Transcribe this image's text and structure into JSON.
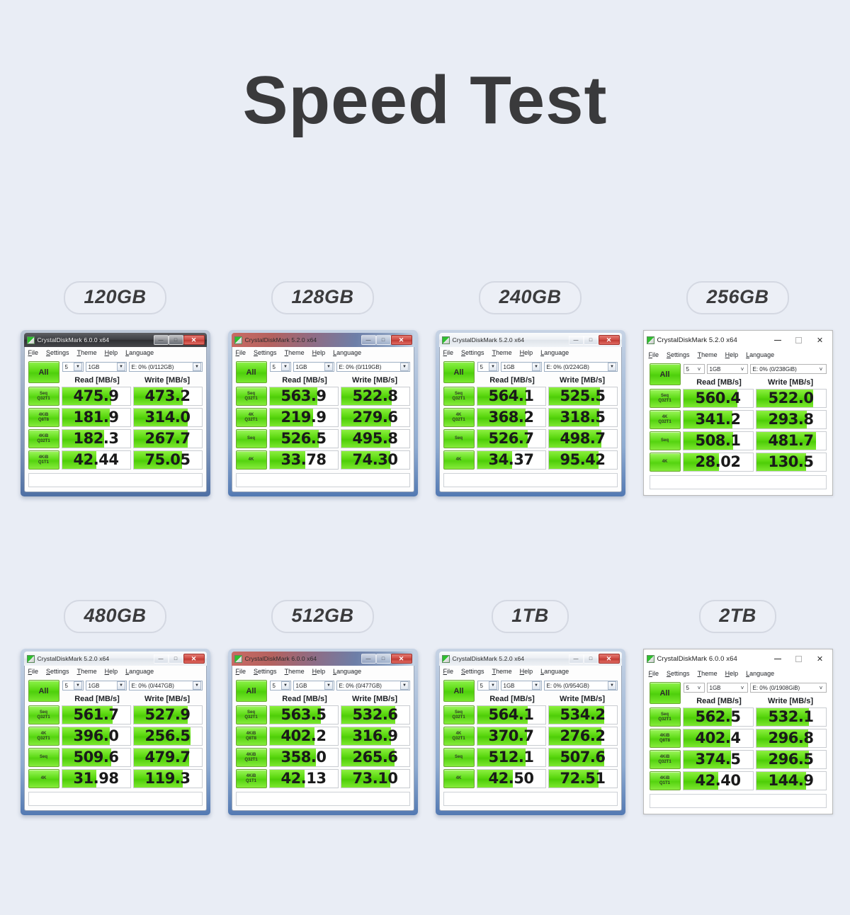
{
  "title": "Speed Test",
  "accent_color": "#57d40d",
  "background_color": "#e9edf5",
  "common": {
    "menu": [
      "File",
      "Settings",
      "Theme",
      "Help",
      "Language"
    ],
    "all_button": "All",
    "read_header": "Read [MB/s]",
    "write_header": "Write [MB/s]",
    "count_value": "5",
    "size_value": "1GB"
  },
  "cards": [
    {
      "capacity": "120GB",
      "window_title": "CrystalDiskMark 6.0.0 x64",
      "titlebar_style": "dark-aero",
      "drive_value": "E: 0% (0/112GB)",
      "rows": [
        {
          "label_top": "Seq",
          "label_bottom": "Q32T1",
          "read": "475.9",
          "write": "473.2",
          "read_bar_pct": 72,
          "write_bar_pct": 72
        },
        {
          "label_top": "4KiB",
          "label_bottom": "Q8T8",
          "read": "181.9",
          "write": "314.0",
          "read_bar_pct": 70,
          "write_bar_pct": 80
        },
        {
          "label_top": "4KiB",
          "label_bottom": "Q32T1",
          "read": "182.3",
          "write": "267.7",
          "read_bar_pct": 62,
          "write_bar_pct": 80
        },
        {
          "label_top": "4KiB",
          "label_bottom": "Q1T1",
          "read": "42.44",
          "write": "75.05",
          "read_bar_pct": 51,
          "write_bar_pct": 71
        }
      ]
    },
    {
      "capacity": "128GB",
      "window_title": "CrystalDiskMark 5.2.0 x64",
      "titlebar_style": "red-aero",
      "drive_value": "E: 0% (0/119GB)",
      "rows": [
        {
          "label_top": "Seq",
          "label_bottom": "Q32T1",
          "read": "563.9",
          "write": "522.8",
          "read_bar_pct": 70,
          "write_bar_pct": 74
        },
        {
          "label_top": "4K",
          "label_bottom": "Q32T1",
          "read": "219.9",
          "write": "279.6",
          "read_bar_pct": 64,
          "write_bar_pct": 73
        },
        {
          "label_top": "Seq",
          "label_bottom": "",
          "read": "526.5",
          "write": "495.8",
          "read_bar_pct": 72,
          "write_bar_pct": 72
        },
        {
          "label_top": "4K",
          "label_bottom": "",
          "read": "33.78",
          "write": "74.30",
          "read_bar_pct": 53,
          "write_bar_pct": 72
        }
      ]
    },
    {
      "capacity": "240GB",
      "window_title": "CrystalDiskMark 5.2.0 x64",
      "titlebar_style": "grey-aero",
      "drive_value": "E: 0% (0/224GB)",
      "rows": [
        {
          "label_top": "Seq",
          "label_bottom": "Q32T1",
          "read": "564.1",
          "write": "525.5",
          "read_bar_pct": 72,
          "write_bar_pct": 75
        },
        {
          "label_top": "4K",
          "label_bottom": "Q32T1",
          "read": "368.2",
          "write": "318.5",
          "read_bar_pct": 71,
          "write_bar_pct": 74
        },
        {
          "label_top": "Seq",
          "label_bottom": "",
          "read": "526.7",
          "write": "498.7",
          "read_bar_pct": 74,
          "write_bar_pct": 78
        },
        {
          "label_top": "4K",
          "label_bottom": "",
          "read": "34.37",
          "write": "95.42",
          "read_bar_pct": 52,
          "write_bar_pct": 73
        }
      ]
    },
    {
      "capacity": "256GB",
      "window_title": "CrystalDiskMark 5.2.0 x64",
      "titlebar_style": "win10-flat",
      "drive_value": "E: 0% (0/238GiB)",
      "rows": [
        {
          "label_top": "Seq",
          "label_bottom": "Q32T1",
          "read": "560.4",
          "write": "522.0",
          "read_bar_pct": 78,
          "write_bar_pct": 82
        },
        {
          "label_top": "4K",
          "label_bottom": "Q32T1",
          "read": "341.2",
          "write": "293.8",
          "read_bar_pct": 71,
          "write_bar_pct": 73
        },
        {
          "label_top": "Seq",
          "label_bottom": "",
          "read": "508.1",
          "write": "481.7",
          "read_bar_pct": 72,
          "write_bar_pct": 86
        },
        {
          "label_top": "4K",
          "label_bottom": "",
          "read": "28.02",
          "write": "130.5",
          "read_bar_pct": 52,
          "write_bar_pct": 72
        }
      ]
    },
    {
      "capacity": "480GB",
      "window_title": "CrystalDiskMark 5.2.0 x64",
      "titlebar_style": "grey-aero",
      "drive_value": "E: 0% (0/447GB)",
      "rows": [
        {
          "label_top": "Seq",
          "label_bottom": "Q32T1",
          "read": "561.7",
          "write": "527.9",
          "read_bar_pct": 74,
          "write_bar_pct": 80
        },
        {
          "label_top": "4K",
          "label_bottom": "Q32T1",
          "read": "396.0",
          "write": "256.5",
          "read_bar_pct": 70,
          "write_bar_pct": 84
        },
        {
          "label_top": "Seq",
          "label_bottom": "",
          "read": "509.6",
          "write": "479.7",
          "read_bar_pct": 72,
          "write_bar_pct": 82
        },
        {
          "label_top": "4K",
          "label_bottom": "",
          "read": "31.98",
          "write": "119.3",
          "read_bar_pct": 51,
          "write_bar_pct": 72
        }
      ]
    },
    {
      "capacity": "512GB",
      "window_title": "CrystalDiskMark 6.0.0 x64",
      "titlebar_style": "red-aero",
      "drive_value": "E: 0% (0/477GB)",
      "rows": [
        {
          "label_top": "Seq",
          "label_bottom": "Q32T1",
          "read": "563.5",
          "write": "532.6",
          "read_bar_pct": 75,
          "write_bar_pct": 80
        },
        {
          "label_top": "4KiB",
          "label_bottom": "Q8T8",
          "read": "402.2",
          "write": "316.9",
          "read_bar_pct": 66,
          "write_bar_pct": 73
        },
        {
          "label_top": "4KiB",
          "label_bottom": "Q32T1",
          "read": "358.0",
          "write": "265.6",
          "read_bar_pct": 68,
          "write_bar_pct": 79
        },
        {
          "label_top": "4KiB",
          "label_bottom": "Q1T1",
          "read": "42.13",
          "write": "73.10",
          "read_bar_pct": 52,
          "write_bar_pct": 72
        }
      ]
    },
    {
      "capacity": "1TB",
      "window_title": "CrystalDiskMark 5.2.0 x64",
      "titlebar_style": "grey-aero",
      "drive_value": "E: 0% (0/954GB)",
      "rows": [
        {
          "label_top": "Seq",
          "label_bottom": "Q32T1",
          "read": "564.1",
          "write": "534.2",
          "read_bar_pct": 74,
          "write_bar_pct": 82
        },
        {
          "label_top": "4K",
          "label_bottom": "Q32T1",
          "read": "370.7",
          "write": "276.2",
          "read_bar_pct": 73,
          "write_bar_pct": 78
        },
        {
          "label_top": "Seq",
          "label_bottom": "",
          "read": "512.1",
          "write": "507.6",
          "read_bar_pct": 71,
          "write_bar_pct": 82
        },
        {
          "label_top": "4K",
          "label_bottom": "",
          "read": "42.50",
          "write": "72.51",
          "read_bar_pct": 53,
          "write_bar_pct": 73
        }
      ]
    },
    {
      "capacity": "2TB",
      "window_title": "CrystalDiskMark 6.0.0 x64",
      "titlebar_style": "win10-flat",
      "drive_value": "E: 0% (0/1908GiB)",
      "rows": [
        {
          "label_top": "Seq",
          "label_bottom": "Q32T1",
          "read": "562.5",
          "write": "532.1",
          "read_bar_pct": 70,
          "write_bar_pct": 76
        },
        {
          "label_top": "4KiB",
          "label_bottom": "Q8T8",
          "read": "402.4",
          "write": "296.8",
          "read_bar_pct": 68,
          "write_bar_pct": 75
        },
        {
          "label_top": "4KiB",
          "label_bottom": "Q32T1",
          "read": "374.5",
          "write": "296.5",
          "read_bar_pct": 69,
          "write_bar_pct": 76
        },
        {
          "label_top": "4KiB",
          "label_bottom": "Q1T1",
          "read": "42.40",
          "write": "144.9",
          "read_bar_pct": 51,
          "write_bar_pct": 72
        }
      ]
    }
  ]
}
